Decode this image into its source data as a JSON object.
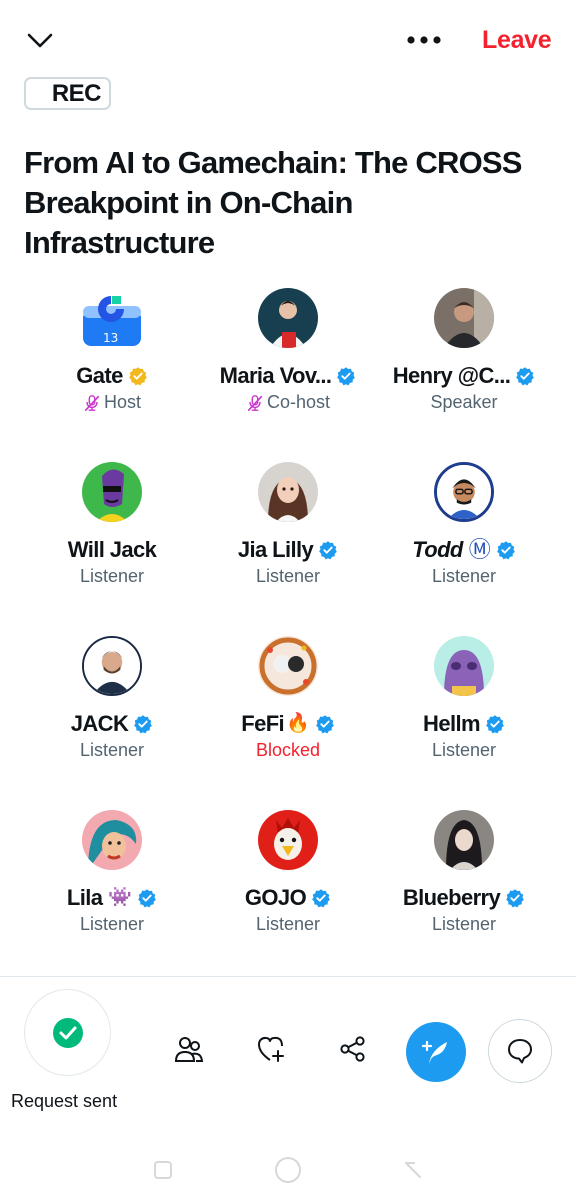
{
  "header": {
    "leave_label": "Leave",
    "rec_label": "REC",
    "more_icon": "more-horizontal-icon",
    "collapse_icon": "chevron-down-icon"
  },
  "space": {
    "title": "From AI to Gamechain: The CROSS Breakpoint in On-Chain Infrastructure"
  },
  "participants": [
    {
      "name": "Gate",
      "role": "Host",
      "verified": "gold",
      "muted": true
    },
    {
      "name": "Maria Vov...",
      "role": "Co-host",
      "verified": "blue",
      "muted": true
    },
    {
      "name": "Henry @C...",
      "role": "Speaker",
      "verified": "blue",
      "muted": false
    },
    {
      "name": "Will Jack",
      "role": "Listener",
      "verified": "none",
      "muted": false
    },
    {
      "name": "Jia Lilly",
      "role": "Listener",
      "verified": "blue",
      "muted": false
    },
    {
      "name": "Todd",
      "role": "Listener",
      "verified": "blue",
      "muted": false,
      "extra": "Ⓜ"
    },
    {
      "name": "JACK",
      "role": "Listener",
      "verified": "blue",
      "muted": false
    },
    {
      "name": "FeFi",
      "role": "Blocked",
      "verified": "blue",
      "muted": false,
      "extra": "🔥"
    },
    {
      "name": "Hellm",
      "role": "Listener",
      "verified": "blue",
      "muted": false
    },
    {
      "name": "Lila",
      "role": "Listener",
      "verified": "blue",
      "muted": false,
      "extra": "👾"
    },
    {
      "name": "GOJO",
      "role": "Listener",
      "verified": "blue",
      "muted": false
    },
    {
      "name": "Blueberry",
      "role": "Listener",
      "verified": "blue",
      "muted": false
    }
  ],
  "bottom": {
    "request_label": "Request sent",
    "icons": [
      "people-icon",
      "heart-plus-icon",
      "share-icon",
      "compose-icon",
      "chat-icon"
    ]
  },
  "colors": {
    "accent": "#1d9bf0",
    "leave": "#f4212e",
    "gold": "#f2b81d",
    "success": "#00ba7c",
    "muted_mic": "#c936cc"
  }
}
